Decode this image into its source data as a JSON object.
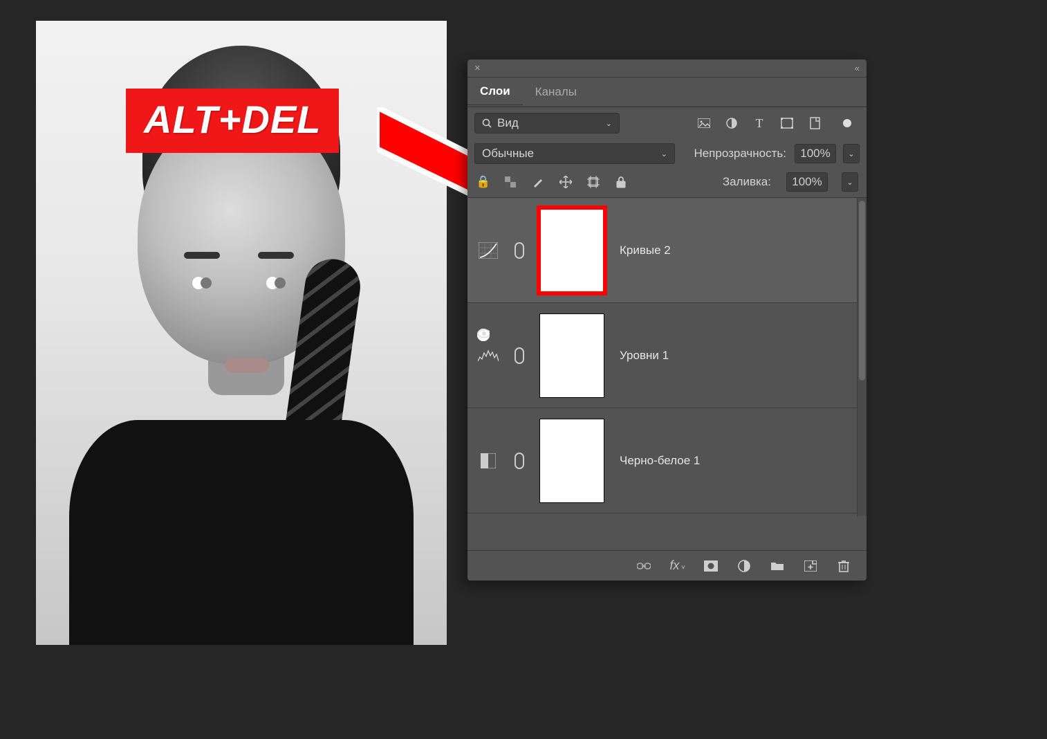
{
  "overlay": {
    "shortcut_label": "ALT+DEL"
  },
  "panel": {
    "tabs": [
      {
        "label": "Слои",
        "active": true
      },
      {
        "label": "Каналы",
        "active": false
      }
    ],
    "search": {
      "label": "Вид"
    },
    "blend_mode": "Обычные",
    "opacity": {
      "label": "Непрозрачность:",
      "value": "100%"
    },
    "fill": {
      "label": "Заливка:",
      "value": "100%"
    },
    "layers": [
      {
        "name": "Кривые 2",
        "type": "curves",
        "selected": true,
        "highlight_mask": true
      },
      {
        "name": "Уровни 1",
        "type": "levels",
        "selected": false,
        "highlight_mask": false
      },
      {
        "name": "Черно-белое 1",
        "type": "bw",
        "selected": false,
        "highlight_mask": false
      }
    ],
    "icons": {
      "close": "×",
      "collapse": "«",
      "menu": "≡",
      "search": "⌕",
      "chev": "⌄",
      "filter_image": "image",
      "filter_adjust": "adjust",
      "filter_text": "T",
      "filter_shape": "shape",
      "filter_smart": "smart",
      "lock_transparent": "lock-pixels",
      "lock_brush": "brush",
      "lock_move": "move",
      "lock_artboard": "crop",
      "lock_all": "lock",
      "footer": [
        "link",
        "fx",
        "mask",
        "adjust",
        "group",
        "new",
        "trash"
      ]
    }
  }
}
